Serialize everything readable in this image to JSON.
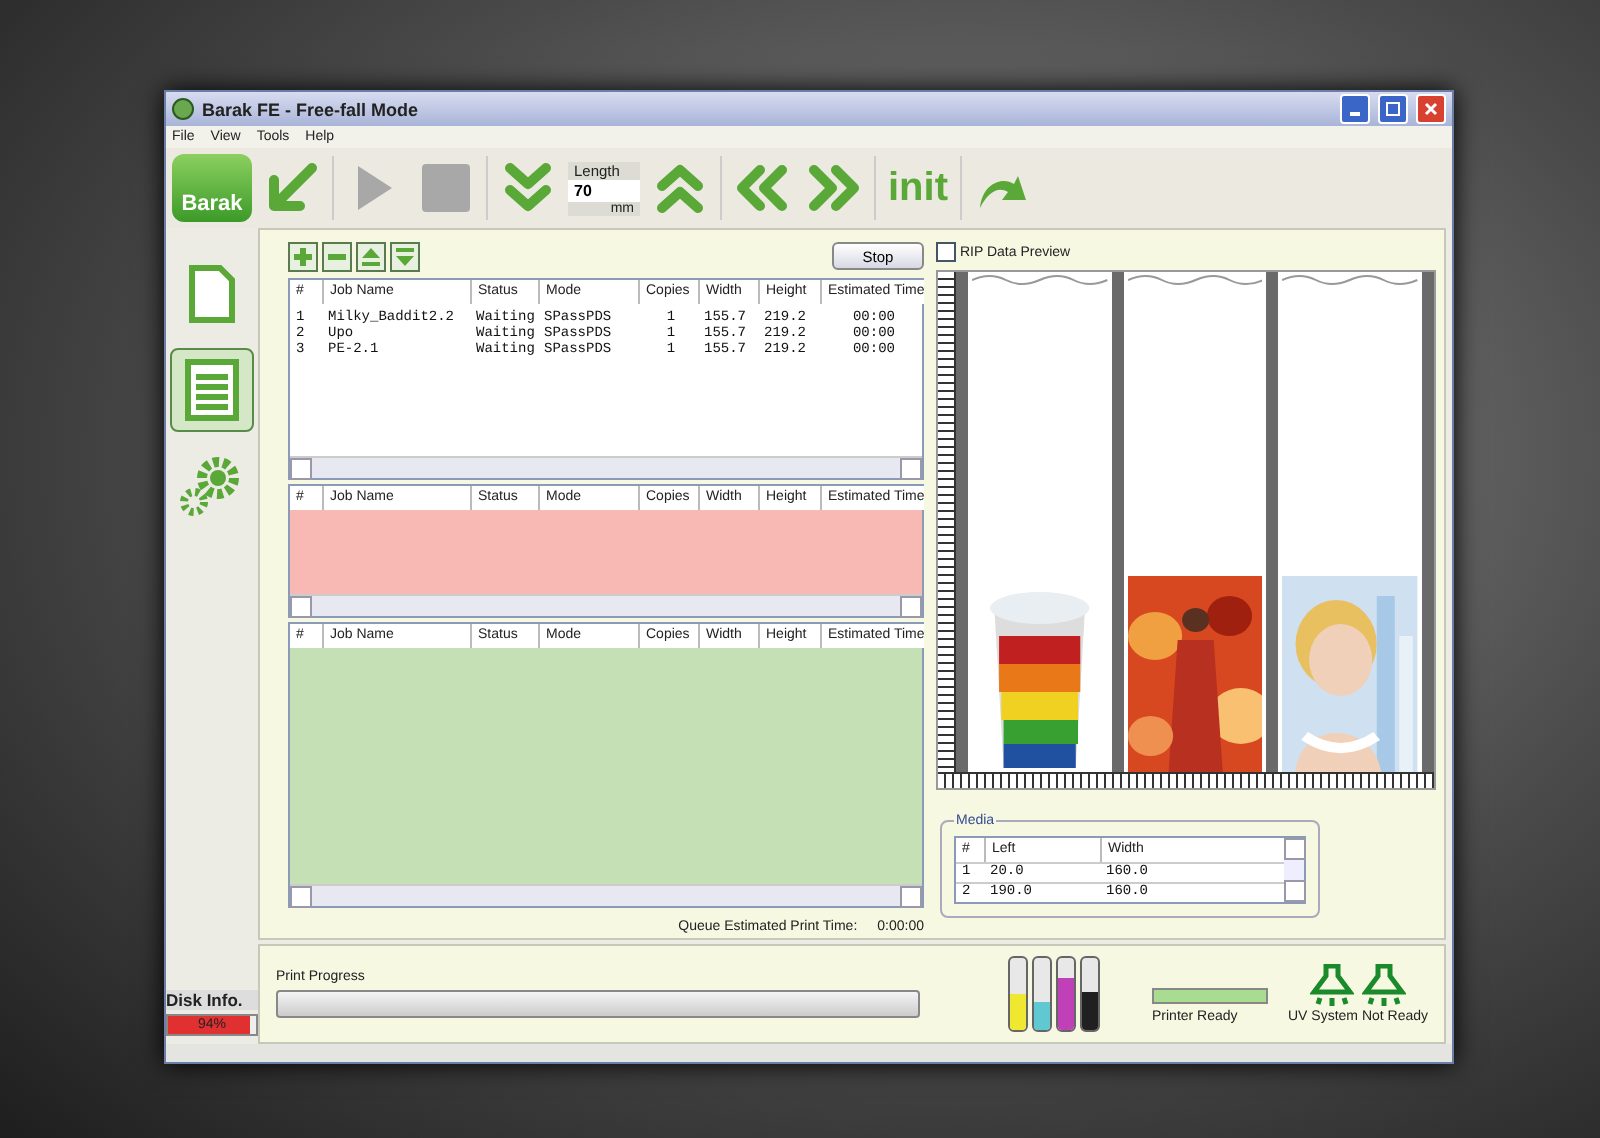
{
  "window": {
    "title": "Barak FE - Free-fall Mode"
  },
  "menu": [
    "File",
    "View",
    "Tools",
    "Help"
  ],
  "toolbar": [
    {
      "kind": "logo",
      "label": "Barak"
    },
    {
      "kind": "arrow-down-left",
      "disabled": false
    },
    {
      "kind": "separator"
    },
    {
      "kind": "play",
      "disabled": true
    },
    {
      "kind": "stop",
      "disabled": true
    },
    {
      "kind": "separator"
    },
    {
      "kind": "chevrons-down",
      "disabled": false
    },
    {
      "kind": "length",
      "label": "Length",
      "value": "70",
      "unit": "mm"
    },
    {
      "kind": "chevrons-up",
      "disabled": false
    },
    {
      "kind": "separator"
    },
    {
      "kind": "chevrons-left",
      "disabled": false
    },
    {
      "kind": "chevrons-right",
      "disabled": false
    },
    {
      "kind": "separator"
    },
    {
      "kind": "text",
      "label": "init"
    },
    {
      "kind": "separator"
    },
    {
      "kind": "redo",
      "disabled": false
    }
  ],
  "sidebar": {
    "items": [
      {
        "kind": "document",
        "selected": false
      },
      {
        "kind": "list",
        "selected": true
      },
      {
        "kind": "gears",
        "selected": false
      }
    ]
  },
  "job_tools": [
    {
      "kind": "add"
    },
    {
      "kind": "remove"
    },
    {
      "kind": "move-up"
    },
    {
      "kind": "move-down"
    }
  ],
  "stop_button": "Stop",
  "queues": [
    {
      "color": "#ffffff",
      "columns": [
        "#",
        "Job Name",
        "Status",
        "Mode",
        "Copies",
        "Width",
        "Height",
        "Estimated Time"
      ],
      "rows": [
        [
          "1",
          "Milky_Baddit2.2",
          "Waiting",
          "SPassPDS",
          "1",
          "155.7",
          "219.2",
          "00:00"
        ],
        [
          "2",
          "Upo",
          "Waiting",
          "SPassPDS",
          "1",
          "155.7",
          "219.2",
          "00:00"
        ],
        [
          "3",
          "PE-2.1",
          "Waiting",
          "SPassPDS",
          "1",
          "155.7",
          "219.2",
          "00:00"
        ]
      ]
    },
    {
      "color": "#f8b8b4",
      "columns": [
        "#",
        "Job Name",
        "Status",
        "Mode",
        "Copies",
        "Width",
        "Height",
        "Estimated Time"
      ]
    },
    {
      "color": "#c4e0b4",
      "columns": [
        "#",
        "Job Name",
        "Status",
        "Mode",
        "Copies",
        "Width",
        "Height",
        "Estimated Time"
      ]
    }
  ],
  "queue_time": {
    "label": "Queue Estimated Print Time:",
    "value": "0:00:00"
  },
  "rip_preview": {
    "label": "RIP Data Preview",
    "checked": false
  },
  "media": {
    "title": "Media",
    "columns": [
      "#",
      "Left",
      "Width"
    ],
    "rows": [
      [
        "1",
        "20.0",
        "160.0"
      ],
      [
        "2",
        "190.0",
        "160.0"
      ]
    ]
  },
  "print_progress": {
    "label": "Print Progress",
    "level": 0
  },
  "inks": [
    {
      "color": "#f0e830",
      "level": 0.5
    },
    {
      "color": "#60c8d0",
      "level": 0.4
    },
    {
      "color": "#c040b8",
      "level": 0.72
    },
    {
      "color": "#202020",
      "level": 0.52
    }
  ],
  "printer_status": {
    "label": "Printer Ready",
    "level": 1
  },
  "uv": {
    "label": "UV System Not Ready"
  },
  "disk": {
    "label": "Disk Info.",
    "value": "94%",
    "level": 0.94
  }
}
